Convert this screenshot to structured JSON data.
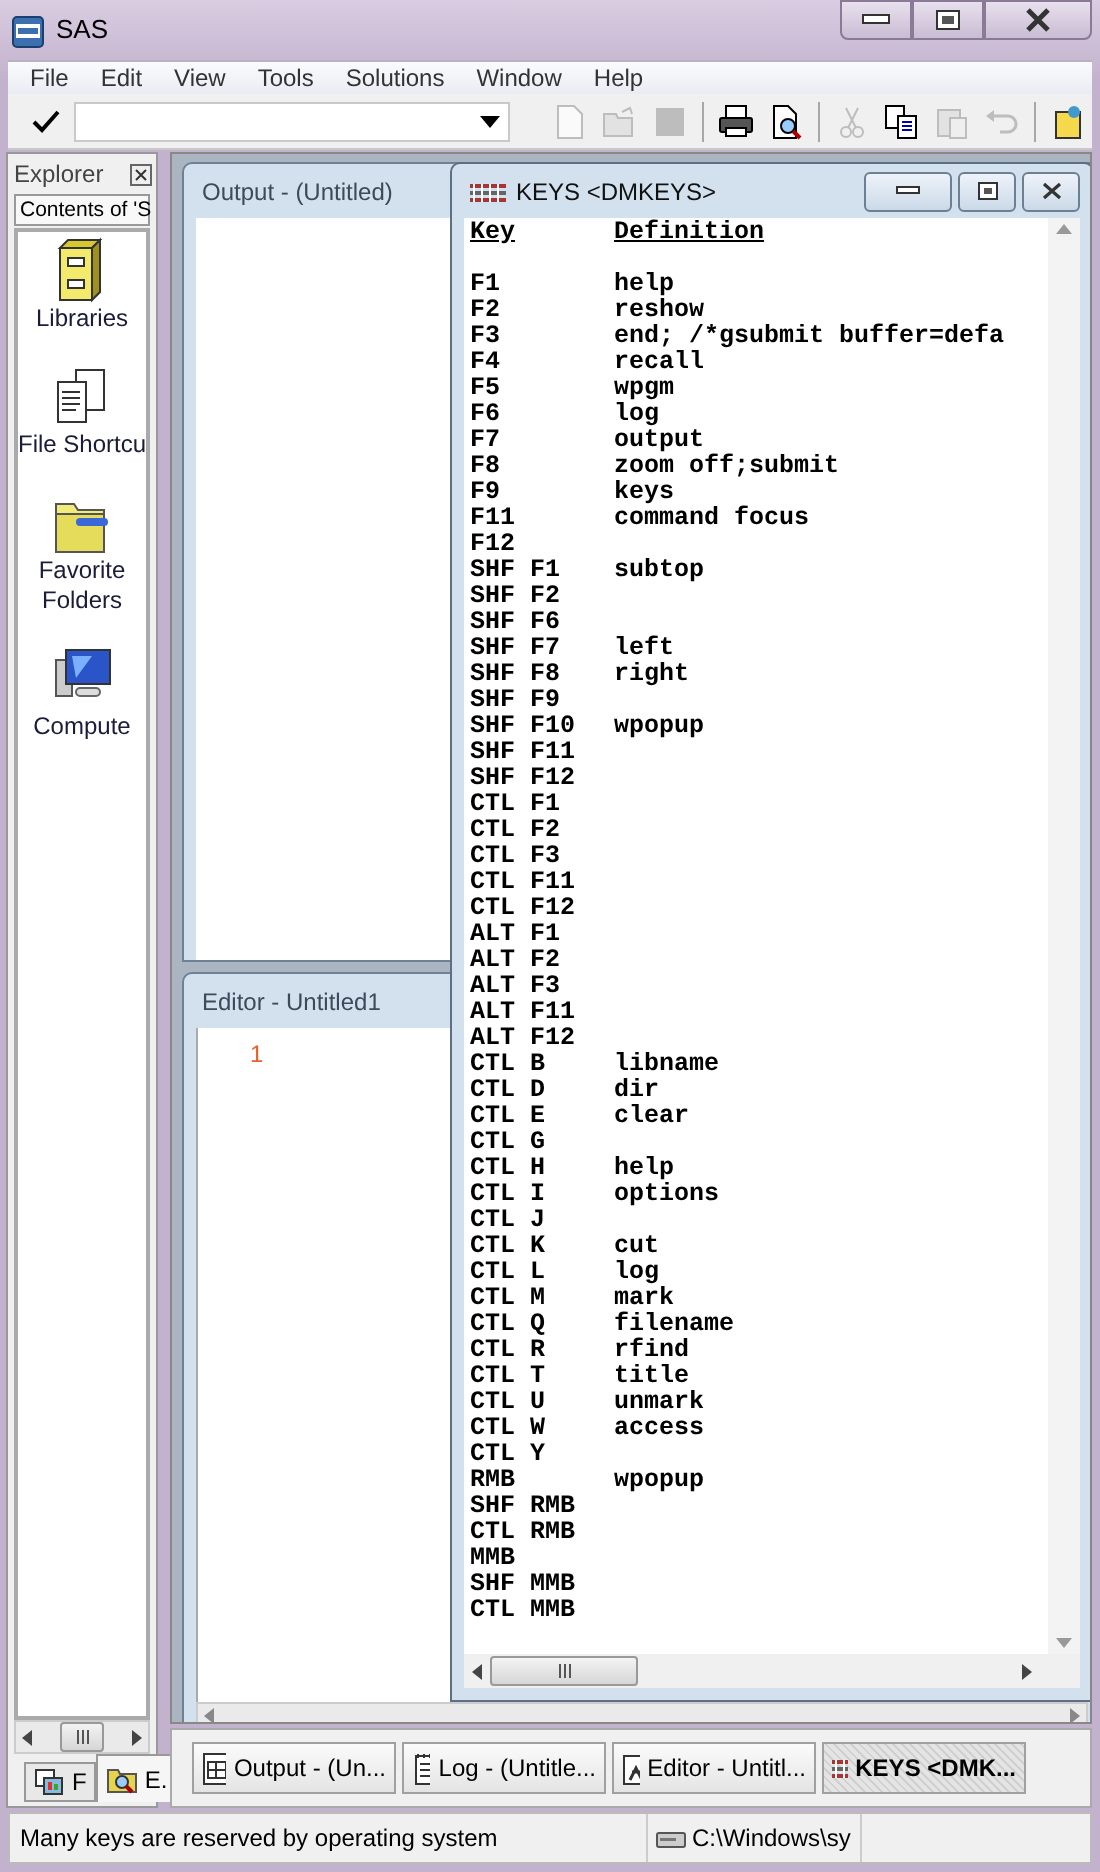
{
  "window": {
    "title": "SAS"
  },
  "menu": [
    "File",
    "Edit",
    "View",
    "Tools",
    "Solutions",
    "Window",
    "Help"
  ],
  "toolbar": [
    {
      "kind": "new",
      "disabled": true
    },
    {
      "kind": "open",
      "disabled": true
    },
    {
      "kind": "save",
      "disabled": true
    },
    {
      "kind": "print",
      "disabled": false
    },
    {
      "kind": "preview",
      "disabled": false
    },
    {
      "kind": "cut",
      "disabled": true
    },
    {
      "kind": "copy",
      "disabled": false
    },
    {
      "kind": "paste",
      "disabled": true
    },
    {
      "kind": "undo",
      "disabled": true
    },
    {
      "kind": "help",
      "disabled": false
    }
  ],
  "explorer": {
    "title": "Explorer",
    "header": "Contents of 'S",
    "items": [
      {
        "label": "Libraries",
        "kind": "cabinet"
      },
      {
        "label": "File Shortcu",
        "kind": "shortcuts"
      },
      {
        "label": "Favorite Folders",
        "kind": "folder"
      },
      {
        "label": "Compute",
        "kind": "computer"
      }
    ],
    "tabs": [
      {
        "label": "F",
        "kind": "results",
        "selected": false
      },
      {
        "label": "E.",
        "kind": "explorer",
        "selected": true
      }
    ]
  },
  "output_window": {
    "title": "Output - (Untitled)"
  },
  "editor_window": {
    "title": "Editor - Untitled1",
    "line_numbers": [
      "1"
    ]
  },
  "keys_window": {
    "title": "KEYS <DMKEYS>",
    "columns": [
      "Key",
      "Definition"
    ],
    "rows": [
      [
        "F1",
        "help"
      ],
      [
        "F2",
        "reshow"
      ],
      [
        "F3",
        "end; /*gsubmit buffer=defa"
      ],
      [
        "F4",
        "recall"
      ],
      [
        "F5",
        "wpgm"
      ],
      [
        "F6",
        "log"
      ],
      [
        "F7",
        "output"
      ],
      [
        "F8",
        "zoom off;submit"
      ],
      [
        "F9",
        "keys"
      ],
      [
        "F11",
        "command focus"
      ],
      [
        "F12",
        ""
      ],
      [
        "SHF F1",
        "subtop"
      ],
      [
        "SHF F2",
        ""
      ],
      [
        "SHF F6",
        ""
      ],
      [
        "SHF F7",
        "left"
      ],
      [
        "SHF F8",
        "right"
      ],
      [
        "SHF F9",
        ""
      ],
      [
        "SHF F10",
        "wpopup"
      ],
      [
        "SHF F11",
        ""
      ],
      [
        "SHF F12",
        ""
      ],
      [
        "CTL F1",
        ""
      ],
      [
        "CTL F2",
        ""
      ],
      [
        "CTL F3",
        ""
      ],
      [
        "CTL F11",
        ""
      ],
      [
        "CTL F12",
        ""
      ],
      [
        "ALT F1",
        ""
      ],
      [
        "ALT F2",
        ""
      ],
      [
        "ALT F3",
        ""
      ],
      [
        "ALT F11",
        ""
      ],
      [
        "ALT F12",
        ""
      ],
      [
        "CTL B",
        "libname"
      ],
      [
        "CTL D",
        "dir"
      ],
      [
        "CTL E",
        "clear"
      ],
      [
        "CTL G",
        ""
      ],
      [
        "CTL H",
        "help"
      ],
      [
        "CTL I",
        "options"
      ],
      [
        "CTL J",
        ""
      ],
      [
        "CTL K",
        "cut"
      ],
      [
        "CTL L",
        "log"
      ],
      [
        "CTL M",
        "mark"
      ],
      [
        "CTL Q",
        "filename"
      ],
      [
        "CTL R",
        "rfind"
      ],
      [
        "CTL T",
        "title"
      ],
      [
        "CTL U",
        "unmark"
      ],
      [
        "CTL W",
        "access"
      ],
      [
        "CTL Y",
        ""
      ],
      [
        "RMB",
        "wpopup"
      ],
      [
        "SHF RMB",
        ""
      ],
      [
        "CTL RMB",
        ""
      ],
      [
        "MMB",
        ""
      ],
      [
        "SHF MMB",
        ""
      ],
      [
        "CTL MMB",
        ""
      ]
    ]
  },
  "window_tabs": [
    {
      "label": "Output - (Un...",
      "kind": "output",
      "selected": false
    },
    {
      "label": "Log - (Untitle...",
      "kind": "log",
      "selected": false
    },
    {
      "label": "Editor - Untitl...",
      "kind": "editor",
      "selected": false
    },
    {
      "label": "KEYS <DMK...",
      "kind": "keys",
      "selected": true
    }
  ],
  "status_bar": {
    "message": "Many keys are reserved by operating system",
    "path": "C:\\Windows\\sy"
  }
}
